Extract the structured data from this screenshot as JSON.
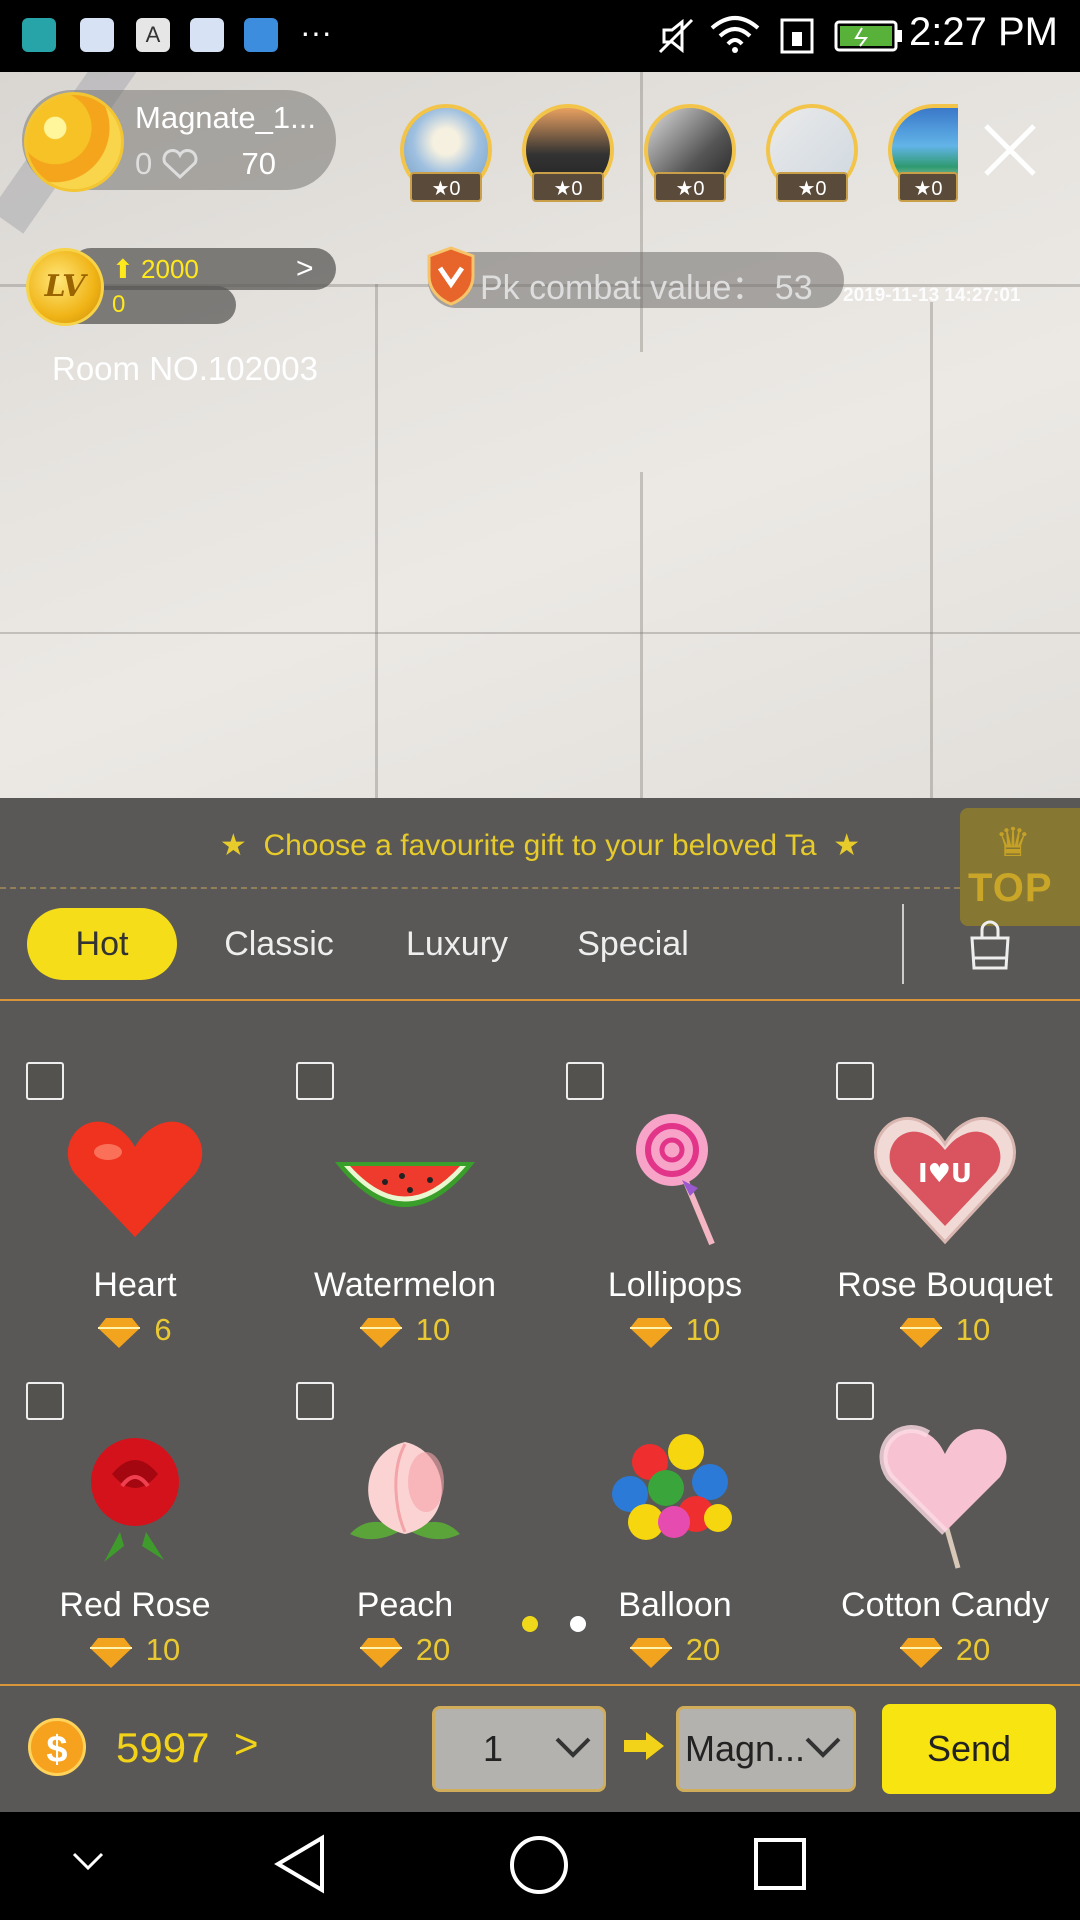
{
  "status_bar": {
    "time": "2:27 PM",
    "more": "···"
  },
  "host": {
    "name": "Magnate_1...",
    "heart_count": "0",
    "score": "70"
  },
  "viewers": [
    {
      "stars": "0"
    },
    {
      "stars": "0"
    },
    {
      "stars": "0"
    },
    {
      "stars": "0"
    },
    {
      "stars": "0"
    }
  ],
  "level": {
    "badge": "LV",
    "up_value": "2000",
    "current": "0"
  },
  "room": {
    "label": "Room NO.102003"
  },
  "pk": {
    "label": "Pk combat value： 53"
  },
  "timestamp": "2019-11-13 14:27:01",
  "gift_panel": {
    "hint": "Choose a favourite gift to your beloved Ta",
    "top_label": "TOP",
    "tabs": [
      {
        "label": "Hot",
        "active": true
      },
      {
        "label": "Classic",
        "active": false
      },
      {
        "label": "Luxury",
        "active": false
      },
      {
        "label": "Special",
        "active": false
      }
    ],
    "gifts": [
      {
        "name": "Heart",
        "price": "6",
        "tag": true,
        "icon": "heart-icon"
      },
      {
        "name": "Watermelon",
        "price": "10",
        "tag": true,
        "icon": "watermelon-icon"
      },
      {
        "name": "Lollipops",
        "price": "10",
        "tag": true,
        "icon": "lollipop-icon"
      },
      {
        "name": "Rose Bouquet",
        "price": "10",
        "tag": true,
        "icon": "rose-bouquet-icon"
      },
      {
        "name": "Red Rose",
        "price": "10",
        "tag": true,
        "icon": "red-rose-icon"
      },
      {
        "name": "Peach",
        "price": "20",
        "tag": true,
        "icon": "peach-icon"
      },
      {
        "name": "Balloon",
        "price": "20",
        "tag": false,
        "icon": "balloon-icon"
      },
      {
        "name": "Cotton Candy",
        "price": "20",
        "tag": true,
        "icon": "cotton-candy-icon"
      }
    ],
    "page_indicator": {
      "pages": 2,
      "current": 1
    }
  },
  "bottom_bar": {
    "coin_symbol": "$",
    "balance": "5997",
    "quantity": "1",
    "recipient": "Magn...",
    "send_label": "Send"
  },
  "colors": {
    "accent_yellow": "#f6dd1a",
    "price_gold": "#e9c832",
    "panel_bg": "#605f5c",
    "divider_orange": "#d9953a"
  }
}
